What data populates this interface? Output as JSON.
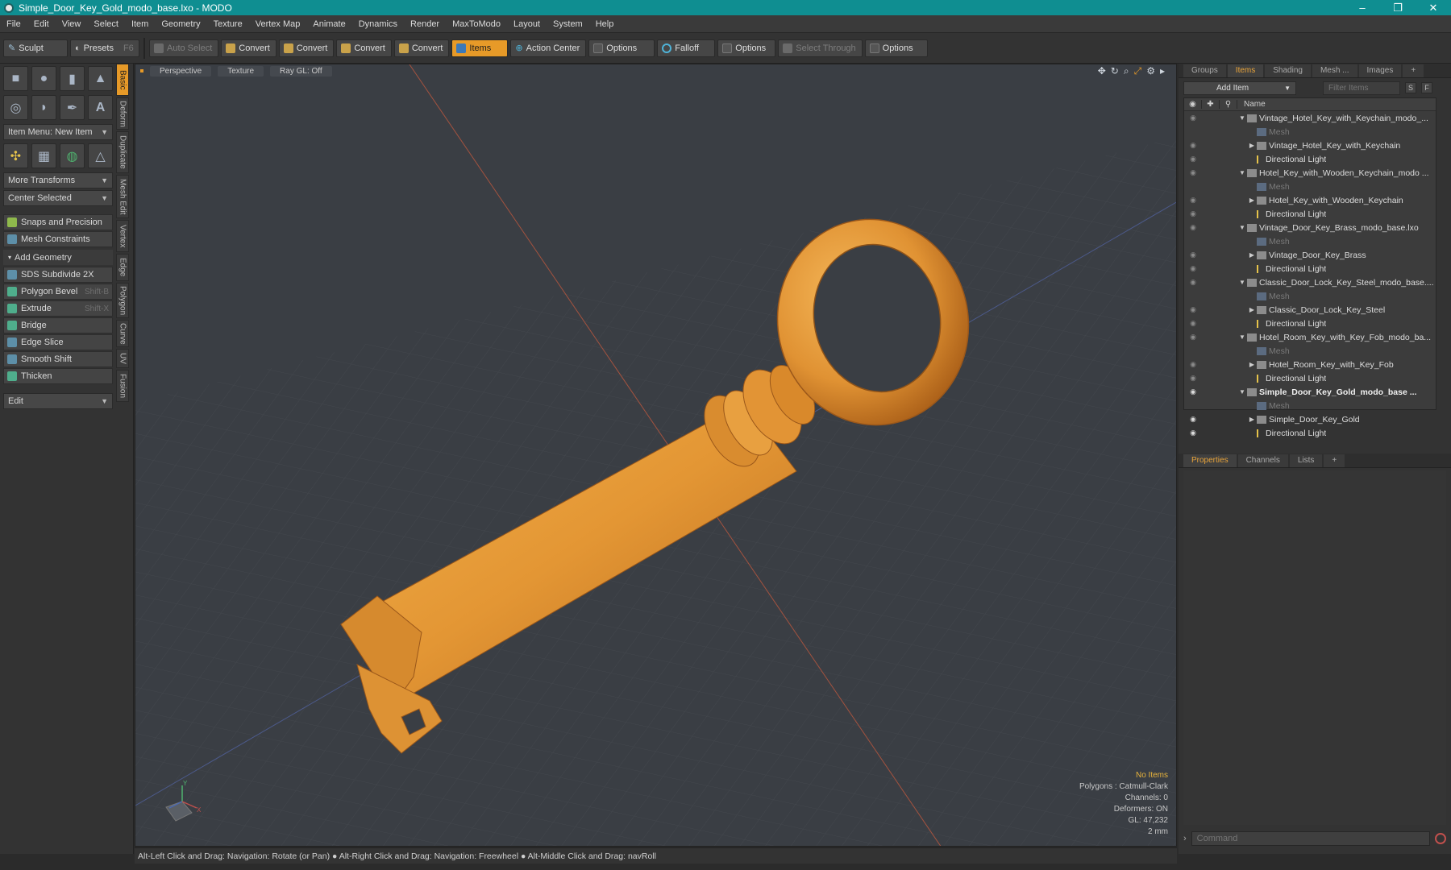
{
  "window": {
    "title": "Simple_Door_Key_Gold_modo_base.lxo - MODO",
    "minimize": "–",
    "maximize": "❐",
    "close": "✕"
  },
  "menu": [
    "File",
    "Edit",
    "View",
    "Select",
    "Item",
    "Geometry",
    "Texture",
    "Vertex Map",
    "Animate",
    "Dynamics",
    "Render",
    "MaxToModo",
    "Layout",
    "System",
    "Help"
  ],
  "toolbar": {
    "sculpt": "Sculpt",
    "presets": "Presets",
    "presets_key": "F6",
    "auto_select": "Auto Select",
    "convert1": "Convert",
    "convert2": "Convert",
    "convert3": "Convert",
    "convert4": "Convert",
    "items": "Items",
    "action_center": "Action Center",
    "options1": "Options",
    "falloff": "Falloff",
    "options2": "Options",
    "select_through": "Select Through",
    "options3": "Options"
  },
  "left": {
    "item_menu": "Item Menu: New Item",
    "more_transforms": "More Transforms",
    "center_selected": "Center Selected",
    "snaps": "Snaps and Precision",
    "mesh_constraints": "Mesh Constraints",
    "add_geometry": "Add Geometry",
    "tools": [
      {
        "label": "SDS Subdivide 2X",
        "key": ""
      },
      {
        "label": "Polygon Bevel",
        "key": "Shift-B"
      },
      {
        "label": "Extrude",
        "key": "Shift-X"
      },
      {
        "label": "Bridge",
        "key": ""
      },
      {
        "label": "Edge Slice",
        "key": ""
      },
      {
        "label": "Smooth Shift",
        "key": ""
      },
      {
        "label": "Thicken",
        "key": ""
      }
    ],
    "edit": "Edit",
    "vtabs": [
      "Basic",
      "Deform",
      "Duplicate",
      "Mesh Edit",
      "Vertex",
      "Edge",
      "Polygon",
      "Curve",
      "UV",
      "Fusion"
    ]
  },
  "viewport": {
    "tabs": [
      "Perspective",
      "Texture",
      "Ray GL: Off"
    ],
    "info": {
      "no_items": "No Items",
      "polygons": "Polygons : Catmull-Clark",
      "channels": "Channels: 0",
      "deformers": "Deformers: ON",
      "gl": "GL: 47,232",
      "scale": "2 mm"
    },
    "tools": [
      "✥",
      "↻",
      "⌕",
      "⤢",
      "⚙",
      "▸"
    ],
    "gizmo": {
      "x": "X",
      "y": "Y"
    }
  },
  "right": {
    "tabs": [
      "Groups",
      "Items",
      "Shading",
      "Mesh ...",
      "Images",
      "+"
    ],
    "add_item": "Add Item",
    "filter_placeholder": "Filter Items",
    "btn_s": "S",
    "btn_f": "F",
    "name_header": "Name",
    "tree": [
      {
        "label": "Vintage_Hotel_Key_with_Keychain_modo_...",
        "type": "scene",
        "depth": 0
      },
      {
        "label": "Mesh",
        "type": "mesh",
        "depth": 1
      },
      {
        "label": "Vintage_Hotel_Key_with_Keychain",
        "type": "group",
        "depth": 1
      },
      {
        "label": "Directional Light",
        "type": "light",
        "depth": 1
      },
      {
        "label": "Hotel_Key_with_Wooden_Keychain_modo ...",
        "type": "scene",
        "depth": 0
      },
      {
        "label": "Mesh",
        "type": "mesh",
        "depth": 1
      },
      {
        "label": "Hotel_Key_with_Wooden_Keychain",
        "type": "group",
        "depth": 1
      },
      {
        "label": "Directional Light",
        "type": "light",
        "depth": 1
      },
      {
        "label": "Vintage_Door_Key_Brass_modo_base.lxo",
        "type": "scene",
        "depth": 0
      },
      {
        "label": "Mesh",
        "type": "mesh",
        "depth": 1
      },
      {
        "label": "Vintage_Door_Key_Brass",
        "type": "group",
        "depth": 1
      },
      {
        "label": "Directional Light",
        "type": "light",
        "depth": 1
      },
      {
        "label": "Classic_Door_Lock_Key_Steel_modo_base....",
        "type": "scene",
        "depth": 0
      },
      {
        "label": "Mesh",
        "type": "mesh",
        "depth": 1
      },
      {
        "label": "Classic_Door_Lock_Key_Steel",
        "type": "group",
        "depth": 1
      },
      {
        "label": "Directional Light",
        "type": "light",
        "depth": 1
      },
      {
        "label": "Hotel_Room_Key_with_Key_Fob_modo_ba...",
        "type": "scene",
        "depth": 0
      },
      {
        "label": "Mesh",
        "type": "mesh",
        "depth": 1
      },
      {
        "label": "Hotel_Room_Key_with_Key_Fob",
        "type": "group",
        "depth": 1
      },
      {
        "label": "Directional Light",
        "type": "light",
        "depth": 1
      },
      {
        "label": "Simple_Door_Key_Gold_modo_base ...",
        "type": "scene",
        "depth": 0,
        "bold": true
      },
      {
        "label": "Mesh",
        "type": "mesh",
        "depth": 1
      },
      {
        "label": "Simple_Door_Key_Gold",
        "type": "group",
        "depth": 1
      },
      {
        "label": "Directional Light",
        "type": "light",
        "depth": 1
      }
    ],
    "props_tabs": [
      "Properties",
      "Channels",
      "Lists",
      "+"
    ],
    "command_placeholder": "Command"
  },
  "status": "Alt-Left Click and Drag: Navigation: Rotate (or Pan) ● Alt-Right Click and Drag: Navigation: Freewheel ● Alt-Middle Click and Drag: navRoll",
  "colors": {
    "accent": "#e79a28",
    "titlebar": "#0f8e91",
    "key_gold": "#e3922e"
  }
}
